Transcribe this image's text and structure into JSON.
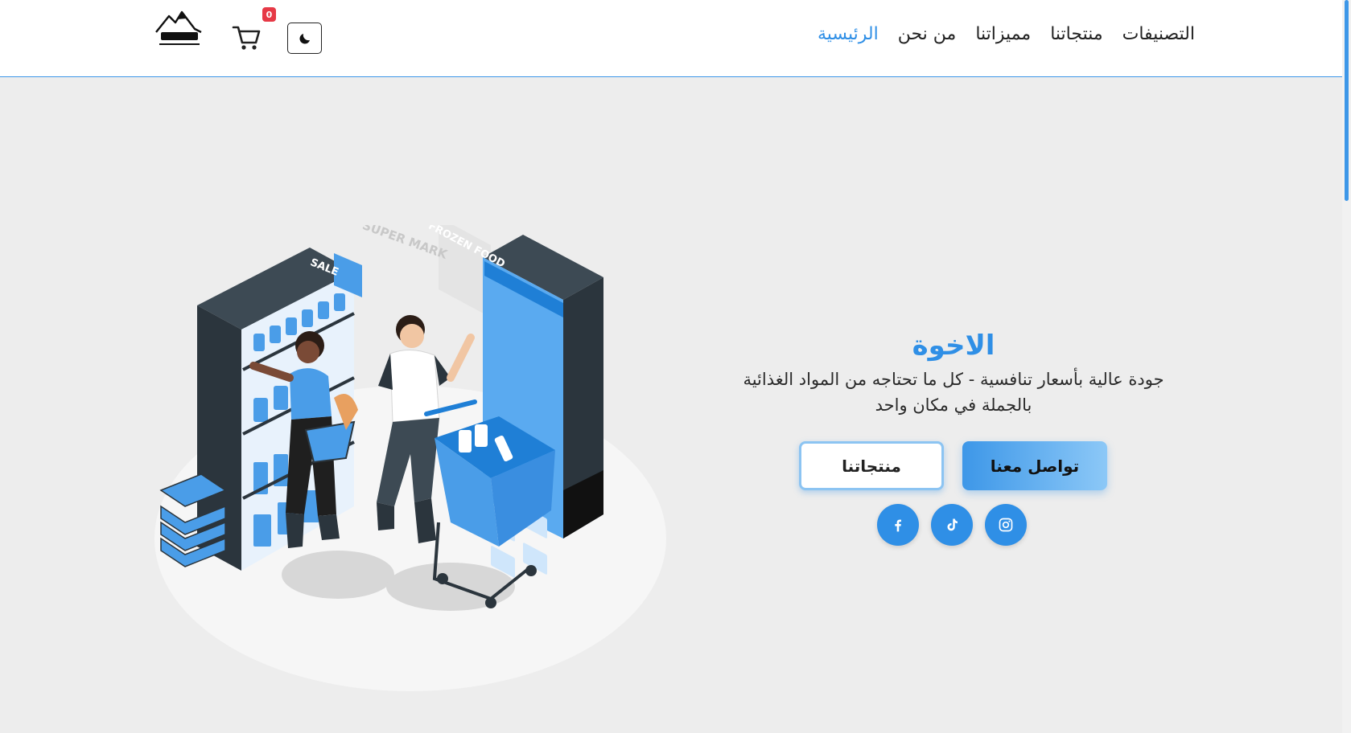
{
  "nav": {
    "items": [
      {
        "label": "التصنيفات"
      },
      {
        "label": "منتجاتنا"
      },
      {
        "label": "مميزاتنا"
      },
      {
        "label": "من نحن"
      },
      {
        "label": "الرئيسية"
      }
    ],
    "active_index": 4
  },
  "cart": {
    "count": "0"
  },
  "icons": {
    "theme": "moon-icon",
    "cart": "shopping-cart-icon",
    "facebook": "facebook-icon",
    "tiktok": "tiktok-icon",
    "instagram": "instagram-icon"
  },
  "hero": {
    "title": "الاخوة",
    "subtitle_line1": "جودة عالية بأسعار تنافسية - كل ما تحتاجه من المواد الغذائية",
    "subtitle_line2": "بالجملة في مكان واحد",
    "cta_primary": "تواصل معنا",
    "cta_secondary": "منتجاتنا"
  },
  "illustration": {
    "sale_sign": "SALE",
    "fridge_sign": "FROZEN FOOD",
    "poster_text": "SUPER MARK"
  },
  "colors": {
    "accent": "#2f8fe6",
    "badge": "#e63946",
    "background": "#ededed",
    "header": "#ffffff"
  }
}
